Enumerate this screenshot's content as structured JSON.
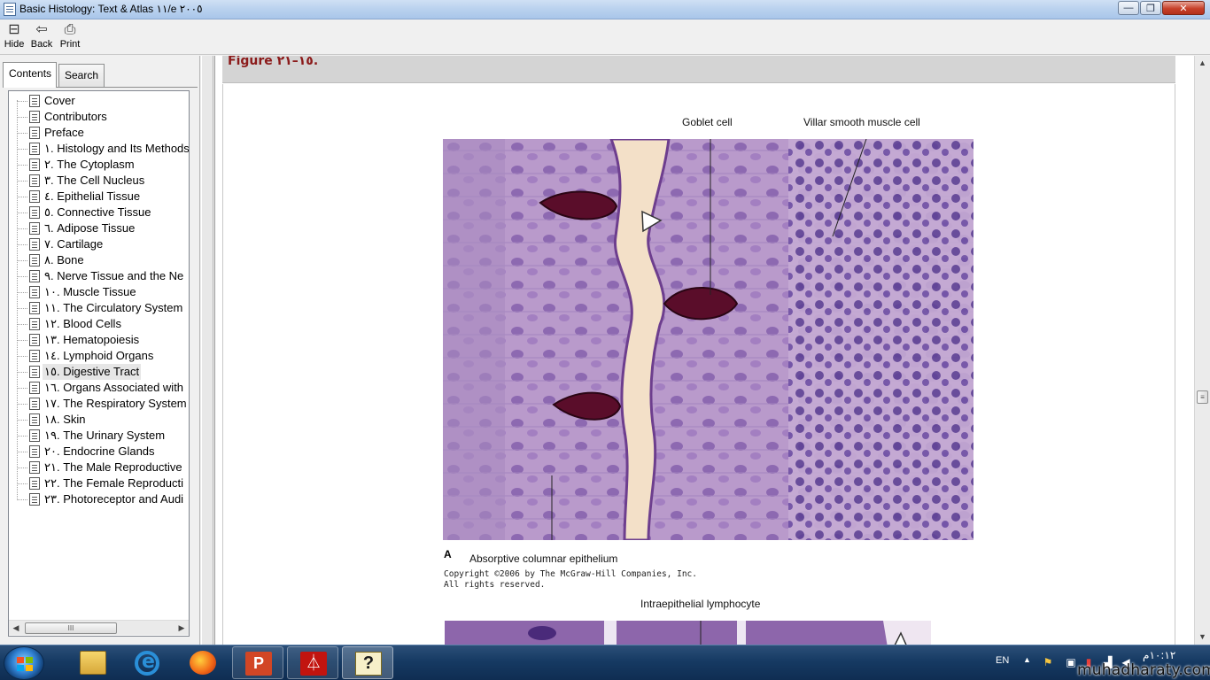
{
  "window": {
    "title": "Basic Histology: Text & Atlas ١١/e ٢٠٠٥",
    "min_glyph": "—",
    "max_glyph": "❐",
    "close_glyph": "✕"
  },
  "toolbar": {
    "hide_label": "Hide",
    "back_label": "Back",
    "print_label": "Print"
  },
  "nav": {
    "tabs": [
      "Contents",
      "Search"
    ],
    "selected_tab": "Contents",
    "items": [
      "Cover",
      "Contributors",
      "Preface",
      "١. Histology and Its Methods",
      "٢. The Cytoplasm",
      "٣. The Cell Nucleus",
      "٤. Epithelial Tissue",
      "٥. Connective Tissue",
      "٦. Adipose Tissue",
      "٧. Cartilage",
      "٨. Bone",
      "٩. Nerve Tissue and the Ne",
      "١٠. Muscle Tissue",
      "١١. The Circulatory System",
      "١٢. Blood Cells",
      "١٣. Hematopoiesis",
      "١٤. Lymphoid Organs",
      "١٥. Digestive Tract",
      "١٦. Organs Associated with",
      "١٧. The Respiratory System",
      "١٨. Skin",
      "١٩. The Urinary System",
      "٢٠. Endocrine Glands",
      "٢١. The Male Reproductive",
      "٢٢. The Female Reproducti",
      "٢٣. Photoreceptor and Audi"
    ],
    "selected_item": "١٥. Digestive Tract",
    "scroll_thumb": "III"
  },
  "content": {
    "figure_caption": "Figure ١٥–٢١.",
    "labels": {
      "goblet": "Goblet cell",
      "villar": "Villar smooth muscle cell",
      "absorptive": "Absorptive columnar epithelium",
      "intra": "Intraepithelial lymphocyte",
      "panel": "A"
    },
    "copyright": [
      "Copyright ©2006 by The McGraw-Hill Companies, Inc.",
      "All rights reserved."
    ]
  },
  "taskbar": {
    "apps": [
      "explorer",
      "internet-explorer",
      "firefox",
      "powerpoint",
      "acrobat",
      "help"
    ],
    "lang": "EN",
    "clock": "١٠:١٢م",
    "watermark": "muhadharaty.com"
  },
  "colors": {
    "tissue_bg": "#b79ac8",
    "tissue_dark": "#6d3e8e",
    "goblet": "#5a0d2a",
    "lumen": "#f3e0c8",
    "caption": "#8b1a1a",
    "taskbar": "#163a63"
  }
}
